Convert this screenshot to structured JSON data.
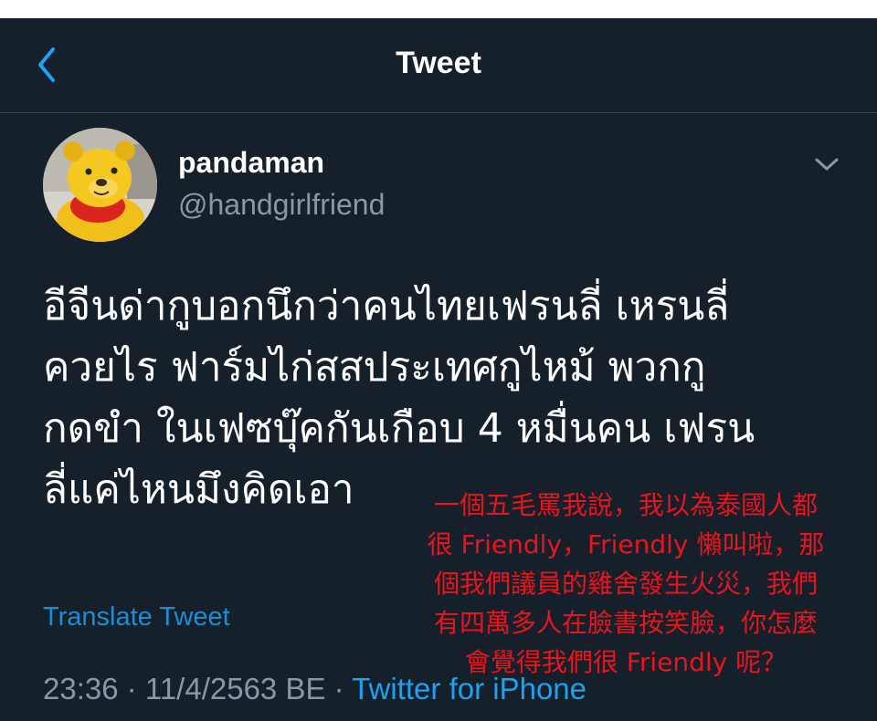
{
  "header": {
    "back_icon": "chevron-left-icon",
    "title": "Tweet"
  },
  "tweet": {
    "author": {
      "display_name": "pandaman",
      "handle": "@handgirlfriend",
      "avatar": "yellow-bear-plush-avatar"
    },
    "menu_icon": "chevron-down-icon",
    "text_lines": [
      "อีจีนด่ากูบอกนึกว่าคนไทยเฟรนลี่ เหรนลี่",
      "ควยไร ฟาร์มไก่สสประเทศกูไหม้ พวกกู",
      "กดขำ ในเฟซบุ๊คกันเกือบ 4 หมื่นคน เฟรน",
      "ลี่แค่ไหนมึงคิดเอา"
    ],
    "translate_label": "Translate Tweet",
    "time": "23:36",
    "separator": " · ",
    "date": "11/4/2563 BE",
    "source": "Twitter for iPhone"
  },
  "overlay_caption": {
    "color": "#e8141e",
    "lines": [
      "一個五毛罵我說，我以為泰國人都",
      "很 Friendly，Friendly 懶叫啦，那",
      "個我們議員的雞舍發生火災，我們",
      "有四萬多人在臉書按笑臉，你怎麼",
      "會覺得我們很 Friendly 呢？"
    ]
  },
  "colors": {
    "background": "#15202b",
    "divider": "#38444d",
    "text": "#ffffff",
    "secondary": "#8899a6",
    "accent": "#1da1f2"
  }
}
